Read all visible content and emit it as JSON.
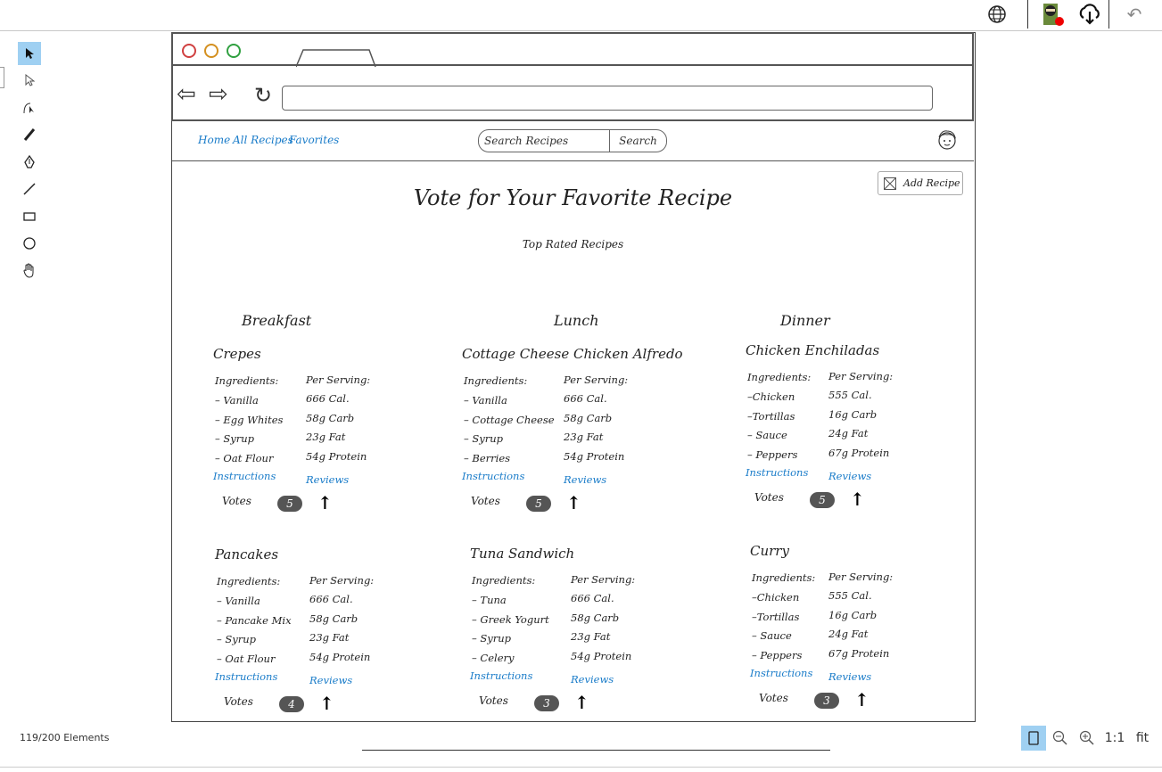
{
  "topbar": {
    "globe_icon": "globe-icon",
    "ninja_icon": "ninja-avatar-icon",
    "cloud_icon": "cloud-download-icon",
    "undo_icon": "undo-icon"
  },
  "tools": [
    {
      "name": "select-tool",
      "glyph": "➤"
    },
    {
      "name": "direct-select-tool",
      "glyph": "⇱"
    },
    {
      "name": "bezier-tool",
      "glyph": "↖"
    },
    {
      "name": "pencil-tool",
      "glyph": "✎"
    },
    {
      "name": "pen-tool",
      "glyph": "✒"
    },
    {
      "name": "line-tool",
      "glyph": "╱"
    },
    {
      "name": "rectangle-tool",
      "glyph": "▭"
    },
    {
      "name": "ellipse-tool",
      "glyph": "○"
    },
    {
      "name": "hand-tool",
      "glyph": "✋"
    }
  ],
  "nav": {
    "home": "Home",
    "all_recipes": "All Recipes",
    "favorites": "Favorites",
    "search_placeholder": "Search Recipes",
    "search_button": "Search"
  },
  "page": {
    "add_recipe": "Add Recipe",
    "title": "Vote for Your Favorite Recipe",
    "subtitle": "Top Rated Recipes"
  },
  "categories": [
    "Breakfast",
    "Lunch",
    "Dinner"
  ],
  "recipes": [
    {
      "name": "Crepes",
      "ingredients_label": "Ingredients:",
      "serving_label": "Per Serving:",
      "ingredients": [
        "– Vanilla",
        "– Egg Whites",
        "– Syrup",
        "– Oat Flour"
      ],
      "nutrition": [
        "666 Cal.",
        "58g Carb",
        "23g Fat",
        "54g Protein"
      ],
      "instructions": "Instructions",
      "reviews": "Reviews",
      "votes_label": "Votes",
      "votes": "5"
    },
    {
      "name": "Cottage Cheese Chicken Alfredo",
      "ingredients_label": "Ingredients:",
      "serving_label": "Per Serving:",
      "ingredients": [
        "– Vanilla",
        "– Cottage Cheese",
        "– Syrup",
        "– Berries"
      ],
      "nutrition": [
        "666 Cal.",
        "58g Carb",
        "23g Fat",
        "54g Protein"
      ],
      "instructions": "Instructions",
      "reviews": "Reviews",
      "votes_label": "Votes",
      "votes": "5"
    },
    {
      "name": "Chicken Enchiladas",
      "ingredients_label": "Ingredients:",
      "serving_label": "Per Serving:",
      "ingredients": [
        "–Chicken",
        "–Tortillas",
        "– Sauce",
        "– Peppers"
      ],
      "nutrition": [
        "555 Cal.",
        "16g Carb",
        "24g Fat",
        "67g Protein"
      ],
      "instructions": "Instructions",
      "reviews": "Reviews",
      "votes_label": "Votes",
      "votes": "5"
    },
    {
      "name": "Pancakes",
      "ingredients_label": "Ingredients:",
      "serving_label": "Per Serving:",
      "ingredients": [
        "– Vanilla",
        "– Pancake Mix",
        "– Syrup",
        "– Oat Flour"
      ],
      "nutrition": [
        "666 Cal.",
        "58g Carb",
        "23g Fat",
        "54g Protein"
      ],
      "instructions": "Instructions",
      "reviews": "Reviews",
      "votes_label": "Votes",
      "votes": "4"
    },
    {
      "name": "Tuna Sandwich",
      "ingredients_label": "Ingredients:",
      "serving_label": "Per Serving:",
      "ingredients": [
        "– Tuna",
        "– Greek Yogurt",
        "– Syrup",
        "– Celery"
      ],
      "nutrition": [
        "666 Cal.",
        "58g Carb",
        "23g Fat",
        "54g Protein"
      ],
      "instructions": "Instructions",
      "reviews": "Reviews",
      "votes_label": "Votes",
      "votes": "3"
    },
    {
      "name": "Curry",
      "ingredients_label": "Ingredients:",
      "serving_label": "Per Serving:",
      "ingredients": [
        "–Chicken",
        "–Tortillas",
        "– Sauce",
        "– Peppers"
      ],
      "nutrition": [
        "555 Cal.",
        "16g Carb",
        "24g Fat",
        "67g Protein"
      ],
      "instructions": "Instructions",
      "reviews": "Reviews",
      "votes_label": "Votes",
      "votes": "3"
    }
  ],
  "status": {
    "elements": "119/200 Elements"
  },
  "zoom": {
    "one_to_one": "1:1",
    "fit": "fit"
  }
}
